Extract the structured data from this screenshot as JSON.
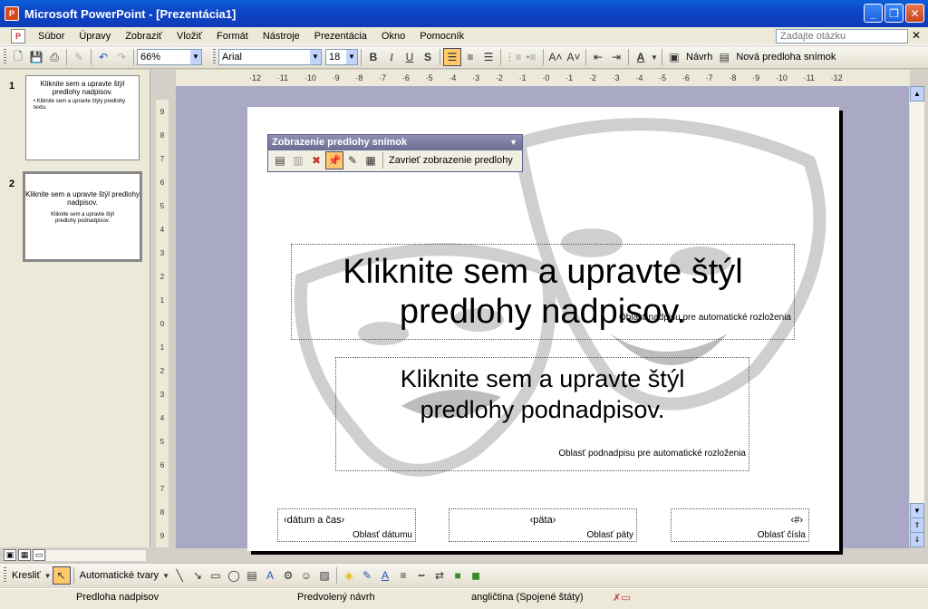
{
  "window": {
    "title": "Microsoft PowerPoint - [Prezentácia1]"
  },
  "menu": {
    "items": [
      "Súbor",
      "Úpravy",
      "Zobraziť",
      "Vložiť",
      "Formát",
      "Nástroje",
      "Prezentácia",
      "Okno",
      "Pomocník"
    ],
    "ask_placeholder": "Zadajte otázku"
  },
  "toolbar": {
    "zoom": "66%",
    "font": "Arial",
    "font_size": "18",
    "design_label": "Návrh",
    "new_master_label": "Nová predloha snímok"
  },
  "ruler_h": [
    "12",
    "11",
    "10",
    "9",
    "8",
    "7",
    "6",
    "5",
    "4",
    "3",
    "2",
    "1",
    "0",
    "1",
    "2",
    "3",
    "4",
    "5",
    "6",
    "7",
    "8",
    "9",
    "10",
    "11",
    "12"
  ],
  "ruler_v": [
    "9",
    "8",
    "7",
    "6",
    "5",
    "4",
    "3",
    "2",
    "1",
    "0",
    "1",
    "2",
    "3",
    "4",
    "5",
    "6",
    "7",
    "8",
    "9"
  ],
  "thumbnails": [
    {
      "number": "1",
      "title": "Kliknite sem a upravte štýl predlohy nadpisov.",
      "body": "• Kliknite sem a upravte štýly predlohy textu."
    },
    {
      "number": "2",
      "title": "Kliknite sem a upravte štýl predlohy nadpisov.",
      "body": "Kliknite sem a upravte štýl predlohy podnadpisov."
    }
  ],
  "master_bar": {
    "title": "Zobrazenie predlohy snímok",
    "close_label": "Zavrieť zobrazenie predlohy"
  },
  "slide": {
    "title_text": "Kliknite sem a upravte štýl predlohy nadpisov.",
    "title_area_label": "Oblasť nadpisu pre automatické rozloženia",
    "subtitle_text": "Kliknite sem a upravte štýl predlohy podnadpisov.",
    "subtitle_area_label": "Oblasť podnadpisu pre automatické rozloženia",
    "date_value": "‹dátum a čas›",
    "date_label": "Oblasť dátumu",
    "footer_value": "‹päta›",
    "footer_label": "Oblasť päty",
    "number_value": "‹#›",
    "number_label": "Oblasť čísla"
  },
  "drawing": {
    "draw_label": "Kresliť",
    "autoshapes_label": "Automatické tvary"
  },
  "status": {
    "master": "Predloha nadpisov",
    "design": "Predvolený návrh",
    "language": "angličtina (Spojené štáty)"
  }
}
